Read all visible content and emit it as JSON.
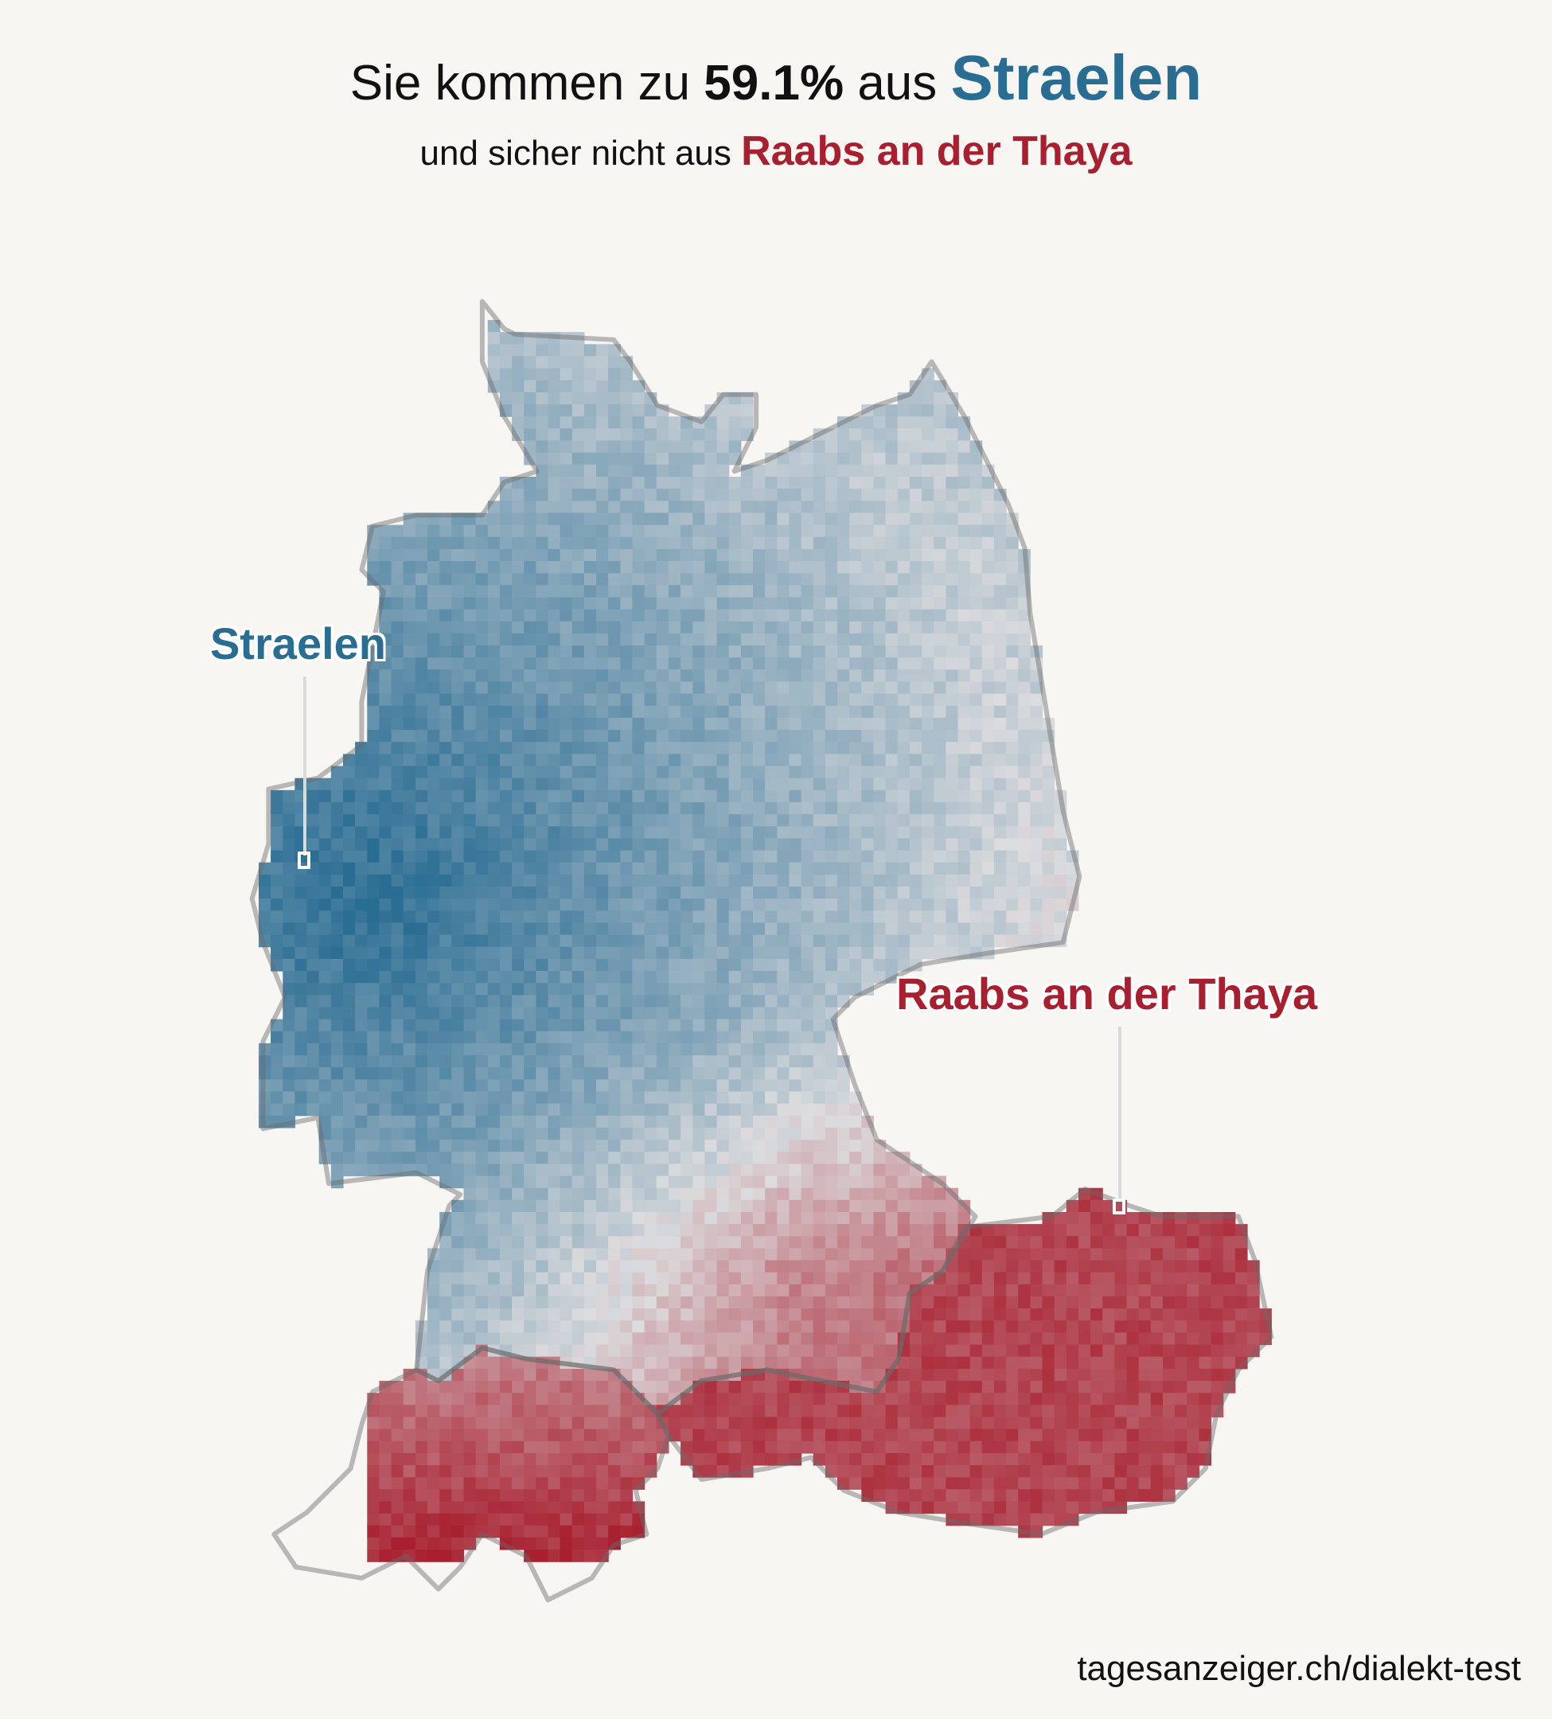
{
  "title": {
    "prefix": "Sie kommen zu",
    "percentage": "59.1%",
    "middle": "aus",
    "best_match": "Straelen"
  },
  "subtitle": {
    "prefix": "und sicher nicht aus",
    "worst_match": "Raabs an der Thaya"
  },
  "map": {
    "regions": [
      "Germany",
      "Austria",
      "Switzerland"
    ],
    "best_label": "Straelen",
    "worst_label": "Raabs an der Thaya",
    "colors": {
      "match_high": "#2a6d93",
      "match_low": "#a8202f",
      "neutral": "#dcdcde",
      "border": "#6b6b6b",
      "background": "#f7f6f3"
    }
  },
  "footer": "tagesanzeiger.ch/dialekt-test"
}
